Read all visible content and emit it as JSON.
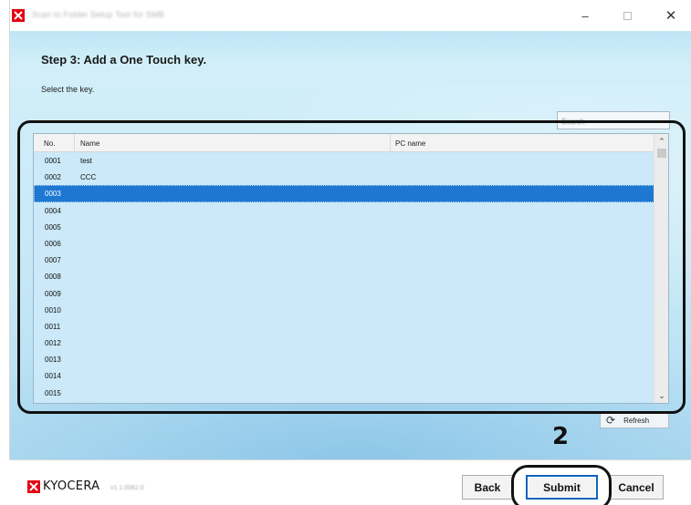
{
  "window": {
    "title": "Scan to Folder Setup Tool for SMB",
    "controls": {
      "minimize": "–",
      "close": "✕"
    }
  },
  "step": {
    "title": "Step 3: Add a One Touch key.",
    "instruction": "Select the key."
  },
  "search": {
    "placeholder": "Search"
  },
  "table": {
    "columns": [
      "No.",
      "Name",
      "PC name"
    ],
    "rows": [
      {
        "no": "0001",
        "name": "test",
        "pc": ""
      },
      {
        "no": "0002",
        "name": "CCC",
        "pc": ""
      },
      {
        "no": "0003",
        "name": "",
        "pc": "",
        "selected": true
      },
      {
        "no": "0004",
        "name": "",
        "pc": ""
      },
      {
        "no": "0005",
        "name": "",
        "pc": ""
      },
      {
        "no": "0006",
        "name": "",
        "pc": ""
      },
      {
        "no": "0007",
        "name": "",
        "pc": ""
      },
      {
        "no": "0008",
        "name": "",
        "pc": ""
      },
      {
        "no": "0009",
        "name": "",
        "pc": ""
      },
      {
        "no": "0010",
        "name": "",
        "pc": ""
      },
      {
        "no": "0011",
        "name": "",
        "pc": ""
      },
      {
        "no": "0012",
        "name": "",
        "pc": ""
      },
      {
        "no": "0013",
        "name": "",
        "pc": ""
      },
      {
        "no": "0014",
        "name": "",
        "pc": ""
      },
      {
        "no": "0015",
        "name": "",
        "pc": ""
      }
    ]
  },
  "refresh": {
    "label": "Refresh",
    "icon": "refresh-icon"
  },
  "callout": {
    "number": "2"
  },
  "footer": {
    "brand": "KYOCERA",
    "version": "v1.1.0062.0",
    "back_label": "Back",
    "submit_label": "Submit",
    "cancel_label": "Cancel"
  },
  "colors": {
    "selection": "#1e78d2",
    "brand_red": "#e60012",
    "submit_border": "#0b63bd"
  }
}
